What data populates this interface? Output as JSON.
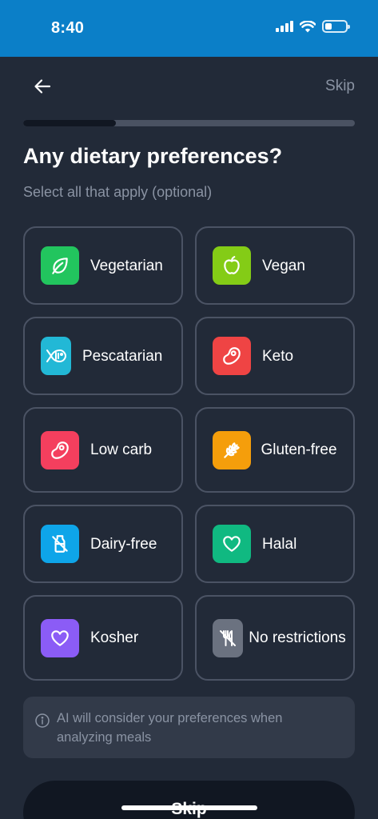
{
  "status_bar": {
    "time": "8:40"
  },
  "header": {
    "skip_label": "Skip"
  },
  "progress": {
    "fraction": 0.28
  },
  "title": "Any dietary preferences?",
  "subtitle": "Select all that apply (optional)",
  "options": [
    {
      "label": "Vegetarian",
      "icon": "leaf-icon",
      "color": "#22c55e"
    },
    {
      "label": "Vegan",
      "icon": "apple-icon",
      "color": "#84cc16"
    },
    {
      "label": "Pescatarian",
      "icon": "fish-icon",
      "color": "#22b8d6"
    },
    {
      "label": "Keto",
      "icon": "steak-icon",
      "color": "#ef4444"
    },
    {
      "label": "Low carb",
      "icon": "steak-icon",
      "color": "#f43f5e"
    },
    {
      "label": "Gluten-free",
      "icon": "wheat-icon",
      "color": "#f59e0b"
    },
    {
      "label": "Dairy-free",
      "icon": "no-milk-icon",
      "color": "#0ea5e9"
    },
    {
      "label": "Halal",
      "icon": "heart-icon",
      "color": "#10b981"
    },
    {
      "label": "Kosher",
      "icon": "heart-icon",
      "color": "#8b5cf6"
    },
    {
      "label": "No restrictions",
      "icon": "no-utensils-icon",
      "color": "#6b7280"
    }
  ],
  "info": {
    "text": "AI will consider your preferences when analyzing meals"
  },
  "skip_button": {
    "label": "Skip"
  }
}
